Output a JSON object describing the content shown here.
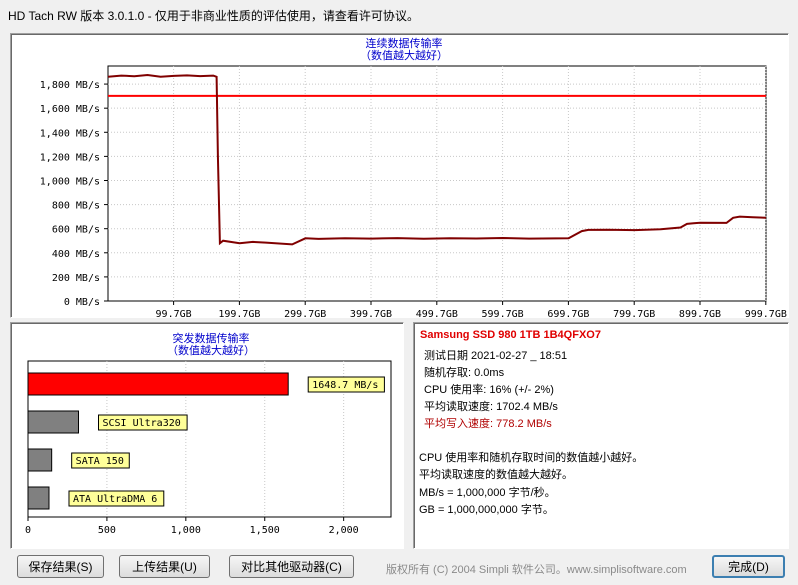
{
  "window": {
    "title": "HD Tach RW 版本 3.0.1.0  - 仅用于非商业性质的评估使用，请查看许可协议。"
  },
  "read_chart": {
    "title": "连续数据传输率",
    "subtitle": "（数值越大越好）",
    "y_ticks": [
      "1,800 MB/s",
      "1,600 MB/s",
      "1,400 MB/s",
      "1,200 MB/s",
      "1,000 MB/s",
      "800 MB/s",
      "600 MB/s",
      "400 MB/s",
      "200 MB/s",
      "0 MB/s"
    ],
    "x_ticks": [
      "99.7GB",
      "199.7GB",
      "299.7GB",
      "399.7GB",
      "499.7GB",
      "599.7GB",
      "699.7GB",
      "799.7GB",
      "899.7GB",
      "999.7GB"
    ],
    "read_color": "#ff0000",
    "write_color": "#800000"
  },
  "chart_data": [
    {
      "type": "line",
      "title": "连续数据传输率",
      "subtitle": "（数值越大越好）",
      "ylim": [
        0,
        1950
      ],
      "xlim": [
        0,
        1000
      ],
      "grid": true,
      "series": [
        {
          "color": "#ff0000",
          "x": [
            0,
            1000
          ],
          "values": [
            1702,
            1702
          ]
        },
        {
          "color": "#800000",
          "x": [
            0,
            20,
            40,
            60,
            80,
            100,
            120,
            140,
            160,
            165,
            167,
            170,
            175,
            200,
            220,
            240,
            280,
            300,
            320,
            360,
            400,
            440,
            480,
            520,
            560,
            600,
            640,
            700,
            720,
            730,
            760,
            800,
            840,
            870,
            880,
            890,
            900,
            940,
            950,
            960,
            980,
            1000
          ],
          "values": [
            1860,
            1870,
            1865,
            1875,
            1860,
            1868,
            1872,
            1866,
            1870,
            1860,
            1200,
            480,
            500,
            480,
            490,
            485,
            470,
            520,
            515,
            520,
            518,
            522,
            516,
            521,
            519,
            523,
            518,
            520,
            580,
            590,
            592,
            588,
            595,
            610,
            640,
            645,
            650,
            648,
            690,
            700,
            695,
            690
          ]
        }
      ]
    },
    {
      "type": "bar",
      "title": "突发数据传输率",
      "subtitle": "（数值越大越好）",
      "orientation": "horizontal",
      "categories": [
        "1648.7 MB/s",
        "SCSI Ultra320",
        "SATA 150",
        "ATA UltraDMA 6"
      ],
      "values": [
        1648.7,
        320,
        150,
        133
      ],
      "x_ticks": [
        "0",
        "500",
        "1,000",
        "1,500",
        "2,000"
      ],
      "xlim": [
        0,
        2300
      ],
      "colors": [
        "#ff0000",
        "#808080",
        "#808080",
        "#808080"
      ]
    }
  ],
  "info": {
    "drive": "Samsung SSD 980 1TB 1B4QFXO7",
    "date": "测试日期 2021-02-27 _ 18:51",
    "random_access": "随机存取: 0.0ms",
    "cpu": "CPU 使用率: 16% (+/- 2%)",
    "avg_read": "平均读取速度: 1702.4 MB/s",
    "avg_write": "平均写入速度: 778.2 MB/s",
    "note1": "CPU 使用率和随机存取时间的数值越小越好。",
    "note2": "平均读取速度的数值越大越好。",
    "note3": "MB/s = 1,000,000 字节/秒。",
    "note4": "GB = 1,000,000,000 字节。"
  },
  "footer": {
    "save": "保存结果(S)",
    "upload": "上传结果(U)",
    "compare": "对比其他驱动器(C)",
    "copyright": "版权所有 (C) 2004 Simpli 软件公司。www.simplisoftware.com",
    "done": "完成(D)"
  }
}
